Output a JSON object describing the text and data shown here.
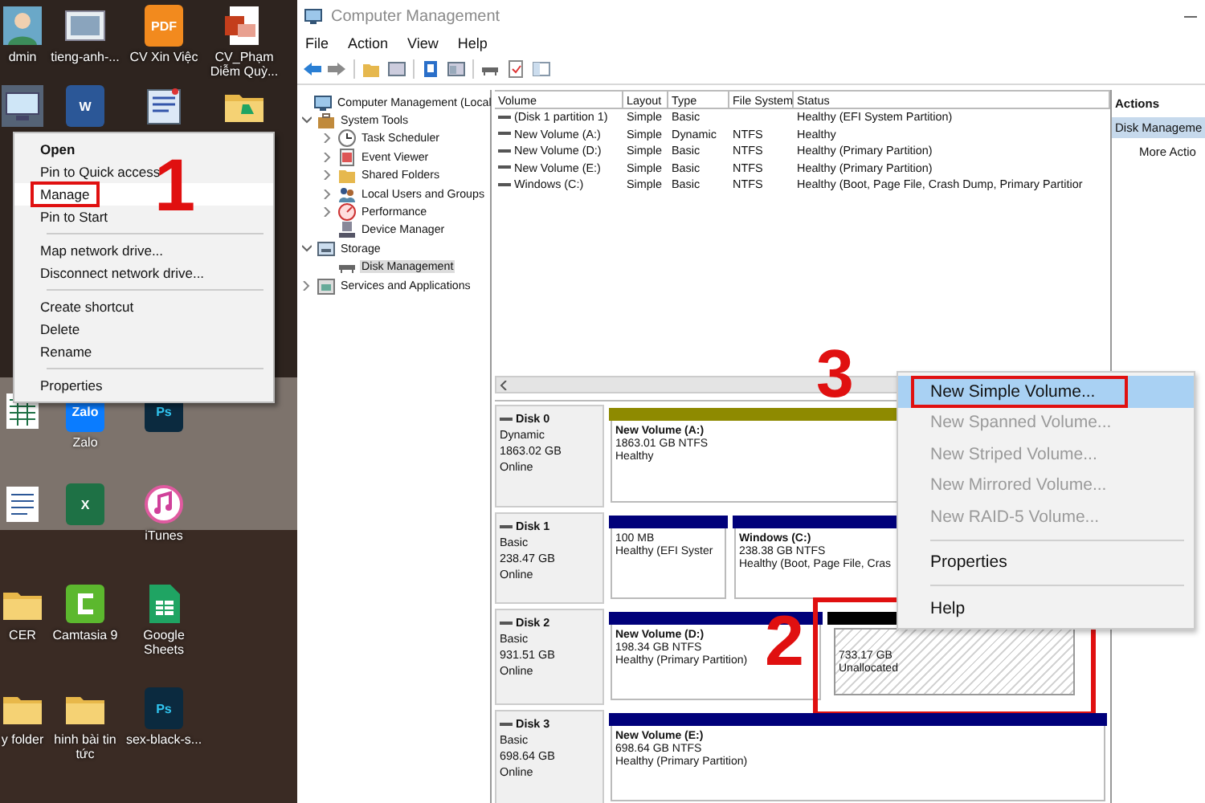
{
  "desktop": {
    "rows": [
      [
        {
          "kind": "user",
          "label": "dmin"
        },
        {
          "kind": "picture",
          "label": "tieng-anh-..."
        },
        {
          "kind": "pdf",
          "glyph": "PDF",
          "label": "CV Xin Việc"
        },
        {
          "kind": "slides",
          "label": "CV_Phạm Diễm Quỳ..."
        }
      ],
      [
        {
          "kind": "computer"
        },
        {
          "kind": "word",
          "glyph": "W"
        },
        {
          "kind": "notepad"
        },
        {
          "kind": "drive"
        }
      ],
      [
        {
          "kind": "sheet"
        },
        {
          "kind": "zalo",
          "glyph": "Zalo",
          "label": "Zalo"
        },
        {
          "kind": "psd",
          "glyph": "Ps"
        }
      ],
      [
        {
          "kind": "doc"
        },
        {
          "kind": "excel",
          "glyph": "X"
        },
        {
          "kind": "music",
          "label": "iTunes"
        }
      ],
      [
        {
          "kind": "folder",
          "label": "CER"
        },
        {
          "kind": "camtasia",
          "label": "Camtasia 9"
        },
        {
          "kind": "sheets",
          "label": "Google Sheets"
        }
      ],
      [
        {
          "kind": "folder",
          "label": "y folder"
        },
        {
          "kind": "folder",
          "label": "hinh bài tin tức"
        },
        {
          "kind": "psd",
          "glyph": "Ps",
          "label": "sex-black-s..."
        }
      ]
    ]
  },
  "context_menu": {
    "items": [
      {
        "kind": "default",
        "label": "Open",
        "selected": false,
        "marked": false
      },
      {
        "kind": "item",
        "label": "Pin to Quick access",
        "selected": false,
        "marked": false
      },
      {
        "kind": "item",
        "label": "Manage",
        "selected": true,
        "marked": true
      },
      {
        "kind": "item",
        "label": "Pin to Start",
        "selected": false,
        "marked": false
      },
      {
        "kind": "separator"
      },
      {
        "kind": "item",
        "label": "Map network drive...",
        "selected": false,
        "marked": false
      },
      {
        "kind": "item",
        "label": "Disconnect network drive...",
        "selected": false,
        "marked": false
      },
      {
        "kind": "separator"
      },
      {
        "kind": "item",
        "label": "Create shortcut",
        "selected": false,
        "marked": false
      },
      {
        "kind": "item",
        "label": "Delete",
        "selected": false,
        "marked": false
      },
      {
        "kind": "item",
        "label": "Rename",
        "selected": false,
        "marked": false
      },
      {
        "kind": "separator"
      },
      {
        "kind": "item",
        "label": "Properties",
        "selected": false,
        "marked": false
      }
    ]
  },
  "window": {
    "title": "Computer Management",
    "menu": [
      "File",
      "Action",
      "View",
      "Help"
    ]
  },
  "tree": [
    {
      "label": "Computer Management (Local",
      "selected": false,
      "children": [
        {
          "label": "System Tools",
          "expanded": true,
          "selected": false,
          "children": [
            {
              "label": "Task Scheduler",
              "expanded": false,
              "selected": false
            },
            {
              "label": "Event Viewer",
              "expanded": false,
              "selected": false
            },
            {
              "label": "Shared Folders",
              "expanded": false,
              "selected": false
            },
            {
              "label": "Local Users and Groups",
              "expanded": false,
              "selected": false
            },
            {
              "label": "Performance",
              "expanded": false,
              "selected": false
            },
            {
              "label": "Device Manager",
              "selected": false
            }
          ]
        },
        {
          "label": "Storage",
          "expanded": true,
          "selected": false,
          "children": [
            {
              "label": "Disk Management",
              "selected": true
            }
          ]
        },
        {
          "label": "Services and Applications",
          "expanded": false,
          "selected": false
        }
      ]
    }
  ],
  "volume_table": {
    "columns": [
      "Volume",
      "Layout",
      "Type",
      "File System",
      "Status"
    ],
    "rows": [
      {
        "volume": "(Disk 1 partition 1)",
        "layout": "Simple",
        "type": "Basic",
        "file_system": "",
        "status": "Healthy (EFI System Partition)"
      },
      {
        "volume": "New Volume (A:)",
        "layout": "Simple",
        "type": "Dynamic",
        "file_system": "NTFS",
        "status": "Healthy"
      },
      {
        "volume": "New Volume (D:)",
        "layout": "Simple",
        "type": "Basic",
        "file_system": "NTFS",
        "status": "Healthy (Primary Partition)"
      },
      {
        "volume": "New Volume (E:)",
        "layout": "Simple",
        "type": "Basic",
        "file_system": "NTFS",
        "status": "Healthy (Primary Partition)"
      },
      {
        "volume": "Windows (C:)",
        "layout": "Simple",
        "type": "Basic",
        "file_system": "NTFS",
        "status": "Healthy (Boot, Page File, Crash Dump, Primary Partitior"
      }
    ]
  },
  "disks": [
    {
      "name": "Disk 0",
      "type": "Dynamic",
      "size": "1863.02 GB",
      "status": "Online",
      "partitions": [
        {
          "kind": "dynamic",
          "title": "New Volume (A:)",
          "size": "1863.01 GB NTFS",
          "status": "Healthy",
          "marked": false
        }
      ]
    },
    {
      "name": "Disk 1",
      "type": "Basic",
      "size": "238.47 GB",
      "status": "Online",
      "partitions": [
        {
          "kind": "primary",
          "size": "100 MB",
          "status": "Healthy (EFI Syster",
          "marked": false
        },
        {
          "kind": "primary",
          "title": "Windows (C:)",
          "size": "238.38 GB NTFS",
          "status": "Healthy (Boot, Page File, Cras",
          "marked": false
        }
      ]
    },
    {
      "name": "Disk 2",
      "type": "Basic",
      "size": "931.51 GB",
      "status": "Online",
      "partitions": [
        {
          "kind": "primary",
          "title": "New Volume (D:)",
          "size": "198.34 GB NTFS",
          "status": "Healthy (Primary Partition)",
          "marked": false
        },
        {
          "kind": "unallocated",
          "size": "733.17 GB",
          "status": "Unallocated",
          "marked": true
        }
      ]
    },
    {
      "name": "Disk 3",
      "type": "Basic",
      "size": "698.64 GB",
      "status": "Online",
      "partitions": [
        {
          "kind": "primary",
          "title": "New Volume (E:)",
          "size": "698.64 GB NTFS",
          "status": "Healthy (Primary Partition)",
          "marked": false
        }
      ]
    }
  ],
  "volume_menu": {
    "items": [
      {
        "kind": "item",
        "label": "New Simple Volume...",
        "disabled": false,
        "selected": true,
        "marked": true
      },
      {
        "kind": "item",
        "label": "New Spanned Volume...",
        "disabled": true,
        "selected": false,
        "marked": false
      },
      {
        "kind": "item",
        "label": "New Striped Volume...",
        "disabled": true,
        "selected": false,
        "marked": false
      },
      {
        "kind": "item",
        "label": "New Mirrored Volume...",
        "disabled": true,
        "selected": false,
        "marked": false
      },
      {
        "kind": "item",
        "label": "New RAID-5 Volume...",
        "disabled": true,
        "selected": false,
        "marked": false
      },
      {
        "kind": "separator"
      },
      {
        "kind": "item",
        "label": "Properties",
        "disabled": false,
        "selected": false,
        "marked": false
      },
      {
        "kind": "separator"
      },
      {
        "kind": "item",
        "label": "Help",
        "disabled": false,
        "selected": false,
        "marked": false
      }
    ]
  },
  "actions": {
    "title": "Actions",
    "items": [
      {
        "kind": "section",
        "label": "Disk Manageme"
      },
      {
        "kind": "link",
        "label": "More Actio"
      }
    ]
  },
  "annotations": [
    {
      "label": "1"
    },
    {
      "label": "2"
    },
    {
      "label": "3"
    }
  ]
}
